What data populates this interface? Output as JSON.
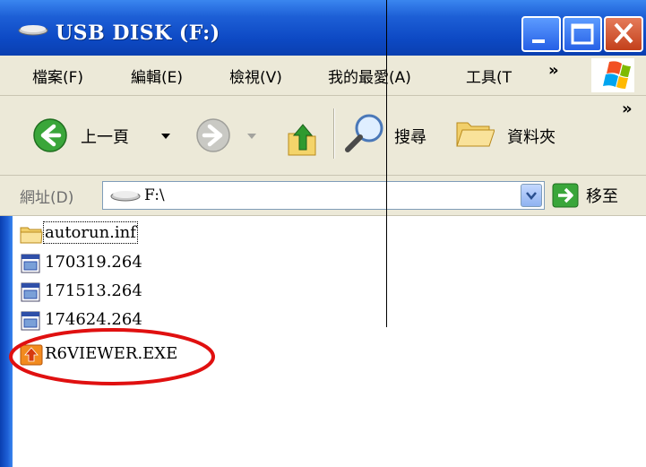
{
  "window": {
    "title": "USB DISK (F:)",
    "controls": {
      "minimize": "minimize",
      "maximize": "maximize",
      "close": "close"
    }
  },
  "menu": {
    "items": [
      "檔案(F)",
      "編輯(E)",
      "檢視(V)",
      "我的最愛(A)",
      "工具(T"
    ],
    "overflow": "»"
  },
  "toolbar": {
    "back_label": "上一頁",
    "search_label": "搜尋",
    "folders_label": "資料夾",
    "overflow": "»"
  },
  "address": {
    "label": "網址(D)",
    "path": "F:\\",
    "go_label": "移至"
  },
  "files": [
    {
      "name": "autorun.inf",
      "icon": "folder-icon"
    },
    {
      "name": "170319.264",
      "icon": "video-file-icon"
    },
    {
      "name": "171513.264",
      "icon": "video-file-icon"
    },
    {
      "name": "174624.264",
      "icon": "video-file-icon"
    },
    {
      "name": "R6VIEWER.EXE",
      "icon": "exe-icon",
      "highlighted": true
    }
  ],
  "colors": {
    "titlebar": "#0d49c4",
    "chrome": "#ece9d8",
    "highlight_ellipse": "#e01010"
  }
}
